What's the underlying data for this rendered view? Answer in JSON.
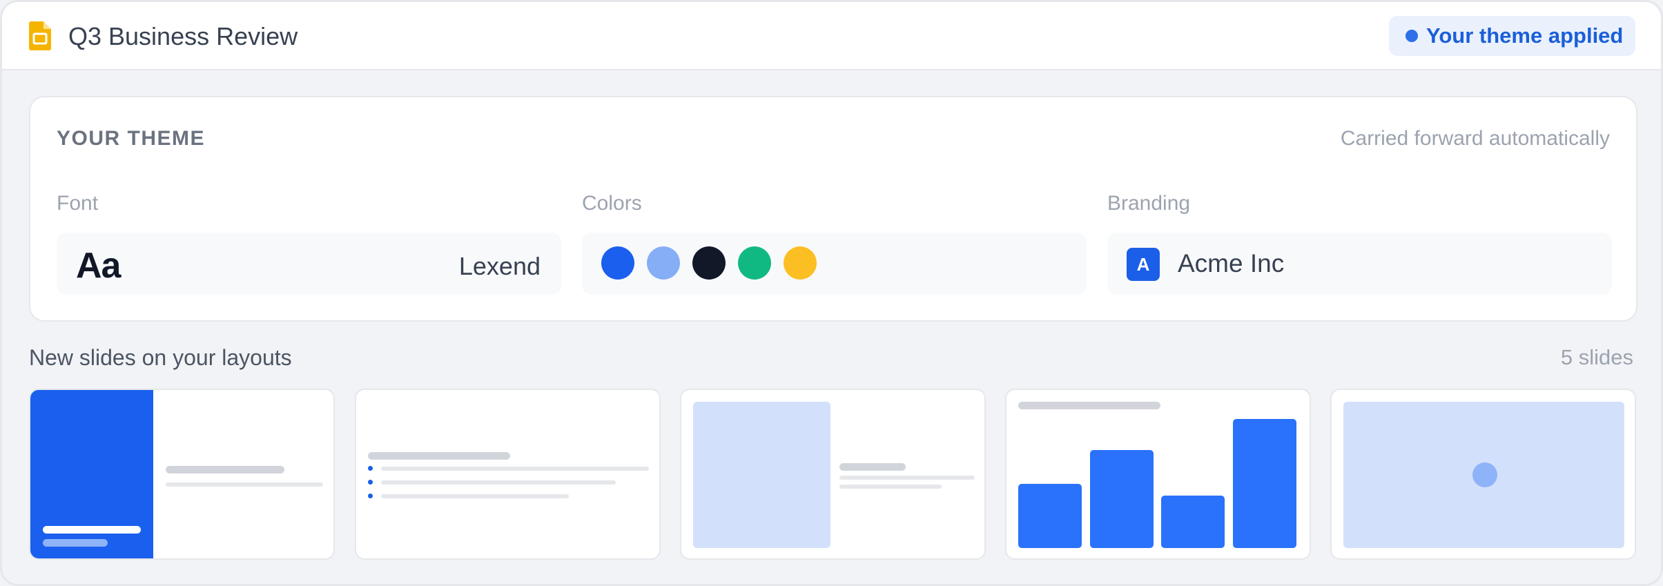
{
  "header": {
    "title": "Q3 Business Review",
    "doc_icon": "slides-doc-icon",
    "status_pill": "Your theme applied"
  },
  "theme": {
    "heading": "YOUR THEME",
    "note": "Carried forward automatically",
    "font": {
      "label": "Font",
      "sample": "Aa",
      "name": "Lexend"
    },
    "colors": {
      "label": "Colors",
      "swatches": [
        "#1a5fee",
        "#86aef7",
        "#111827",
        "#10b981",
        "#fbbf24"
      ]
    },
    "branding": {
      "label": "Branding",
      "logo_letter": "A",
      "name": "Acme Inc"
    }
  },
  "slides": {
    "title": "New slides on your layouts",
    "count": "5 slides",
    "layouts": [
      "title-slide",
      "bulleted-list",
      "image-and-text",
      "bar-chart",
      "full-image"
    ],
    "chart_bars": [
      0.44,
      0.67,
      0.36,
      0.88
    ]
  },
  "colors": {
    "accent": "#1b5fe8",
    "pill_bg": "#eaf1fd",
    "background": "#f2f3f6"
  }
}
